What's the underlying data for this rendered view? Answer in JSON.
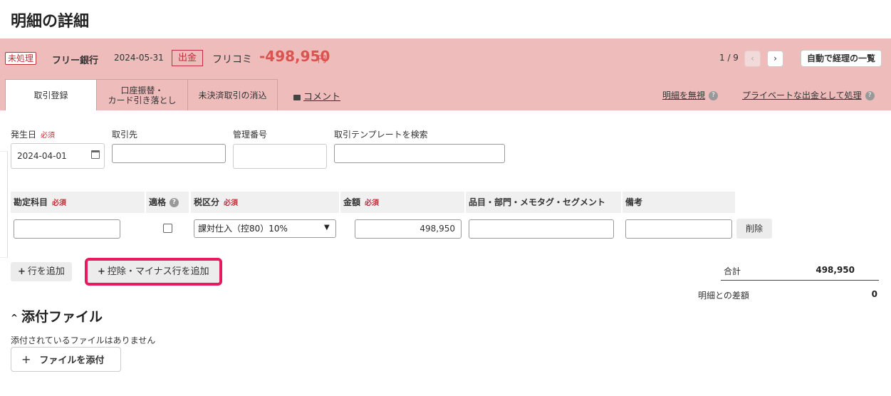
{
  "page": {
    "title": "明細の詳細"
  },
  "txn": {
    "status": "未処理",
    "bank": "フリー銀行",
    "date": "2024-05-31",
    "direction": "出金",
    "description": "フリコミ",
    "amount": "-498,950",
    "currency": "円"
  },
  "pager": {
    "position": "1 / 9",
    "prev": "‹",
    "next": "›",
    "auto_list": "自動で経理の一覧"
  },
  "tabs": [
    {
      "label": "取引登録",
      "active": true
    },
    {
      "label_line1": "口座振替・",
      "label_line2": "カード引き落とし"
    },
    {
      "label": "未決済取引の消込"
    }
  ],
  "links": {
    "comment": "コメント",
    "ignore": "明細を無視",
    "private": "プライベートな出金として処理"
  },
  "form": {
    "date_label": "発生日",
    "required": "必須",
    "date_value": "2024-04-01",
    "partner_label": "取引先",
    "ref_label": "管理番号",
    "template_label": "取引テンプレートを検索"
  },
  "table": {
    "headers": {
      "account": "勘定科目",
      "eligible": "適格",
      "tax": "税区分",
      "amount": "金額",
      "tags": "品目・部門・メモタグ・セグメント",
      "note": "備考"
    },
    "row": {
      "tax_value": "課対仕入（控80）10%",
      "amount": "498,950",
      "delete": "削除"
    }
  },
  "actions": {
    "add_row": "行を追加",
    "add_minus_row": "控除・マイナス行を追加"
  },
  "summary": {
    "total_label": "合計",
    "total_value": "498,950",
    "diff_label": "明細との差額",
    "diff_value": "0"
  },
  "attachments": {
    "title": "添付ファイル",
    "empty": "添付されているファイルはありません",
    "add_button": "ファイルを添付"
  }
}
